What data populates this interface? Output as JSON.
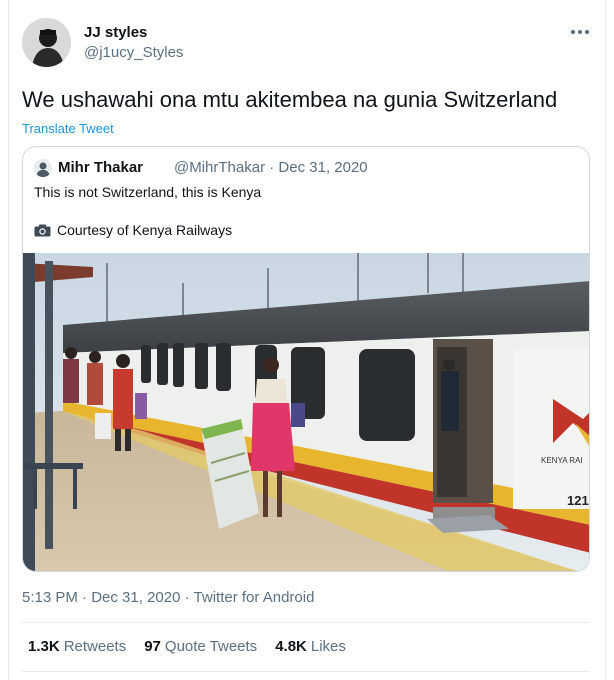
{
  "tweet": {
    "author_name": "JJ styles",
    "author_handle": "@j1ucy_Styles",
    "text": "We ushawahi ona mtu akitembea na gunia Switzerland",
    "translate_label": "Translate Tweet",
    "more_icon": "more-icon"
  },
  "quoted": {
    "author_name": "Mihr Thakar",
    "author_handle": "@MihrThakar",
    "separator": "·",
    "date": "Dec 31, 2020",
    "line1": "This is not Switzerland, this is Kenya",
    "line2": "Courtesy of Kenya Railways",
    "camera_icon": "camera-icon",
    "train_car_number": "121",
    "train_brand_text": "KENYA RAI"
  },
  "meta": {
    "time": "5:13 PM",
    "date": "Dec 31, 2020",
    "source": "Twitter for Android",
    "sep": "·"
  },
  "stats": {
    "retweets_count": "1.3K",
    "retweets_label": "Retweets",
    "quotes_count": "97",
    "quotes_label": "Quote Tweets",
    "likes_count": "4.8K",
    "likes_label": "Likes"
  },
  "colors": {
    "link": "#1b95e0",
    "secondary": "#5b7083",
    "border": "#cfd9de"
  }
}
